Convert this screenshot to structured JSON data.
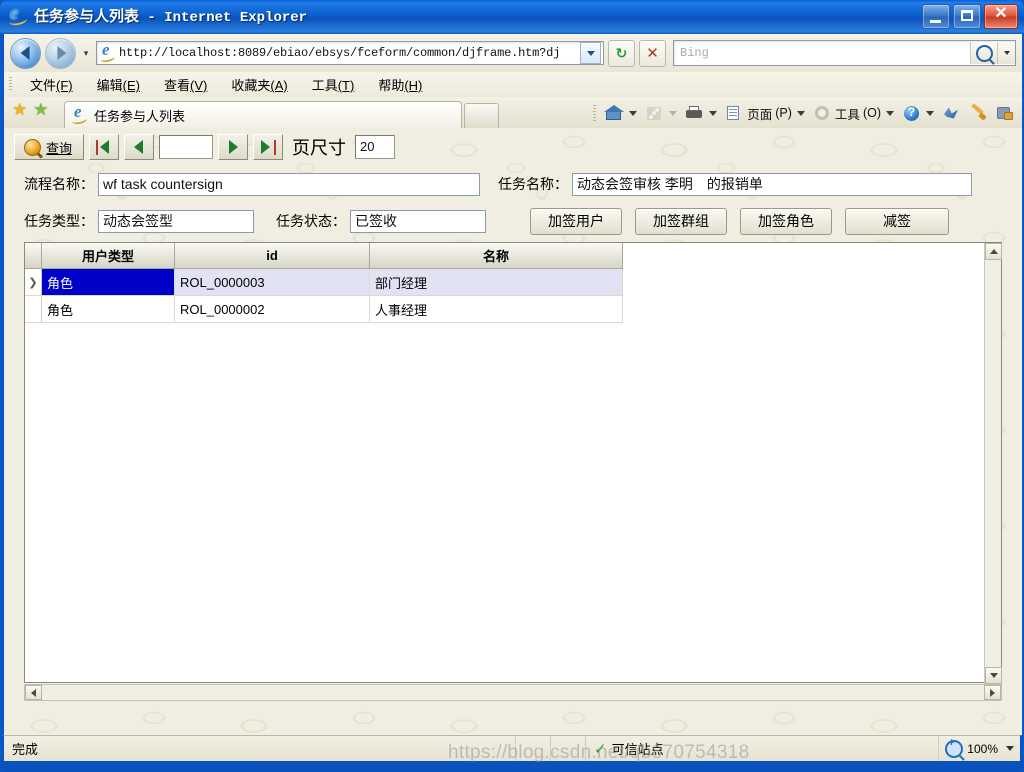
{
  "window": {
    "title_cn": "任务参与人列表",
    "title_sep": " - ",
    "title_app": "Internet Explorer",
    "minimize_label": "_",
    "maximize_label": "□",
    "close_label": "✕"
  },
  "navbar": {
    "back_label": "后退",
    "forward_label": "前进",
    "history_dropdown_label": "▾",
    "url": "http://localhost:8089/ebiao/ebsys/fceform/common/djframe.htm?dj",
    "url_dropdown_label": "▾",
    "refresh_label": "↻",
    "stop_label": "✕",
    "search_placeholder": "Bing",
    "search_go_label": "搜索",
    "search_dropdown_label": "▾"
  },
  "menu": {
    "items": [
      {
        "label": "文件",
        "accel": "(F)"
      },
      {
        "label": "编辑",
        "accel": "(E)"
      },
      {
        "label": "查看",
        "accel": "(V)"
      },
      {
        "label": "收藏夹",
        "accel": "(A)"
      },
      {
        "label": "工具",
        "accel": "(T)"
      },
      {
        "label": "帮助",
        "accel": "(H)"
      }
    ]
  },
  "tabbar": {
    "favorites_label": "收藏中心",
    "add_favorite_label": "添加到收藏夹",
    "tab_label": "任务参与人列表",
    "new_tab_label": ""
  },
  "commandbar": {
    "home_label": "主页",
    "feeds_label": "源",
    "print_label": "打印",
    "page_label": "页面",
    "page_accel": "(P)",
    "tools_label": "工具",
    "tools_accel": "(O)",
    "help_label": "帮助"
  },
  "page_toolbar": {
    "query_label": "查询",
    "first_label": "第一页",
    "prev_label": "上一页",
    "page_value": "",
    "next_label": "下一页",
    "last_label": "最后一页",
    "pagesize_label": "页尺寸",
    "pagesize_value": "20"
  },
  "form": {
    "process_name_label": "流程名称：",
    "process_name_value": "wf task countersign",
    "task_name_label": "任务名称：",
    "task_name_value": "动态会签审核 李明　的报销单",
    "task_type_label": "任务类型：",
    "task_type_value": "动态会签型",
    "task_status_label": "任务状态：",
    "task_status_value": "已签收",
    "buttons": [
      {
        "label": "加签用户"
      },
      {
        "label": "加签群组"
      },
      {
        "label": "加签角色"
      },
      {
        "label": "减签"
      }
    ]
  },
  "grid": {
    "row_indicator": "❯",
    "columns": [
      "用户类型",
      "id",
      "名称"
    ],
    "rows": [
      {
        "selected": true,
        "cells": [
          "角色",
          "ROL_0000003",
          "部门经理"
        ]
      },
      {
        "selected": false,
        "cells": [
          "角色",
          "ROL_0000002",
          "人事经理"
        ]
      }
    ]
  },
  "scrollbars": {
    "up_label": "向上",
    "down_label": "向下",
    "left_label": "向左",
    "right_label": "向右"
  },
  "statusbar": {
    "status_text": "完成",
    "zone_text": "可信站点",
    "zoom_text": "100%",
    "zoom_dropdown_label": "▾"
  },
  "watermark": {
    "text": "https://blog.csdn.net/qb870754318"
  },
  "colors": {
    "titlebar_blue": "#0a58c8",
    "selection_blue": "#0000c8",
    "selected_row_bg": "#e2e2f5",
    "chrome_bg": "#efeee1",
    "grid_header_bg": "#d7d5c6"
  }
}
